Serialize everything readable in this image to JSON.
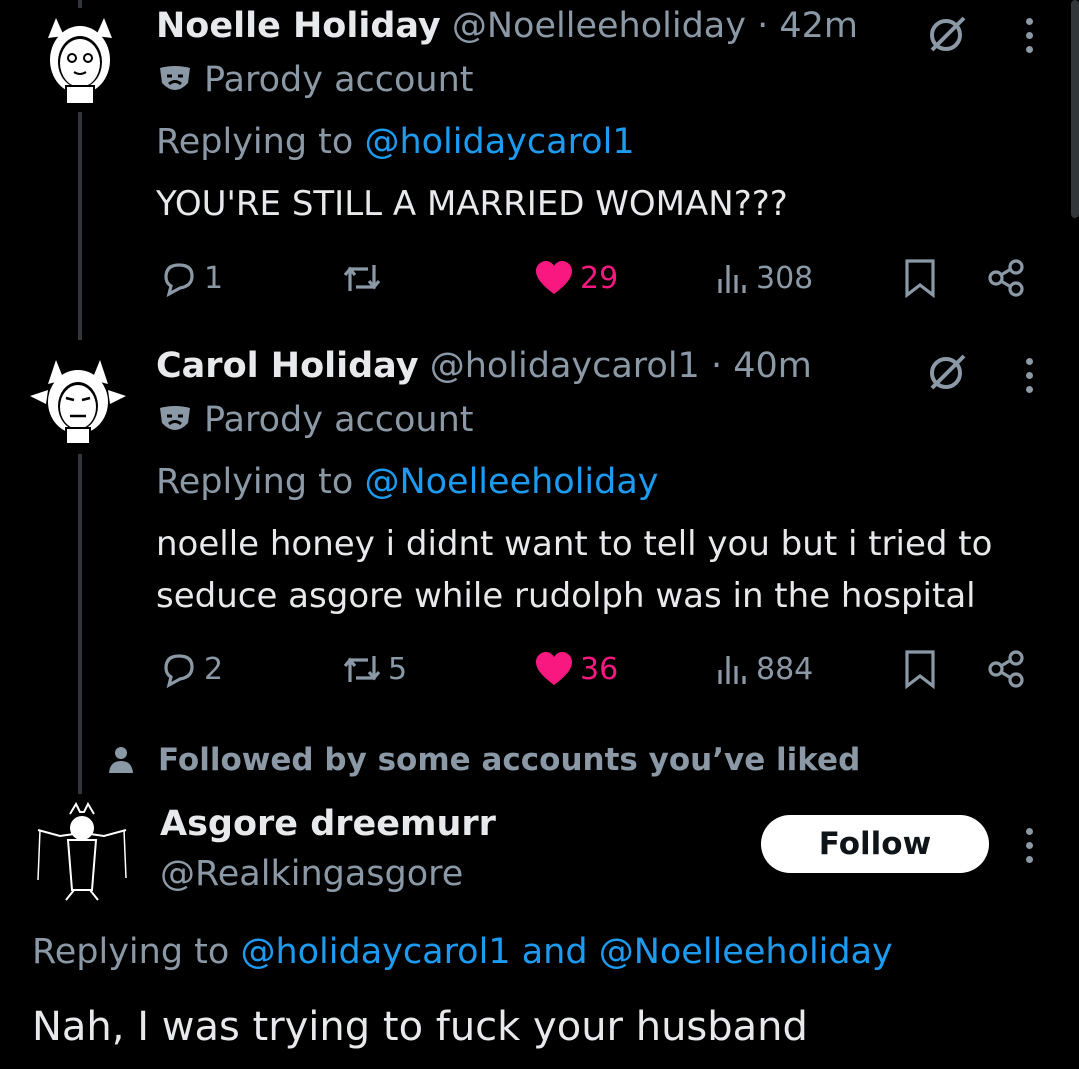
{
  "tweets": [
    {
      "name": "Noelle Holiday",
      "handle": "@Noelleeholiday",
      "time": "· 42m",
      "badge": "Parody account",
      "replying_prefix": "Replying to ",
      "replying_to": "@holidaycarol1",
      "text": "YOU'RE STILL A MARRIED WOMAN???",
      "stats": {
        "replies": "1",
        "reposts": "",
        "likes": "29",
        "views": "308"
      }
    },
    {
      "name": "Carol Holiday",
      "handle": "@holidaycarol1",
      "time": "· 40m",
      "badge": "Parody account",
      "replying_prefix": "Replying to ",
      "replying_to": "@Noelleeholiday",
      "text_line1": "noelle honey i didnt want to tell you but i tried to",
      "text_line2": "seduce asgore while rudolph was in the hospital",
      "stats": {
        "replies": "2",
        "reposts": "5",
        "likes": "36",
        "views": "884"
      }
    }
  ],
  "followed_notice": "Followed by some accounts you’ve liked",
  "main_tweet": {
    "name": "Asgore dreemurr",
    "handle": "@Realkingasgore",
    "follow_label": "Follow",
    "replying_prefix": "Replying to ",
    "replying_to_1": "@holidaycarol1",
    "replying_and": " and ",
    "replying_to_2": "@Noelleeholiday",
    "text": "Nah, I was trying to fuck your husband"
  },
  "colors": {
    "background": "#000000",
    "link": "#1d9bf0",
    "like": "#f91880",
    "secondary": "#8b98a5"
  },
  "icons": [
    "reply-icon",
    "repost-icon",
    "heart-icon",
    "views-icon",
    "bookmark-icon",
    "share-icon",
    "grok-icon",
    "more-icon",
    "parody-mask-icon",
    "person-icon"
  ]
}
